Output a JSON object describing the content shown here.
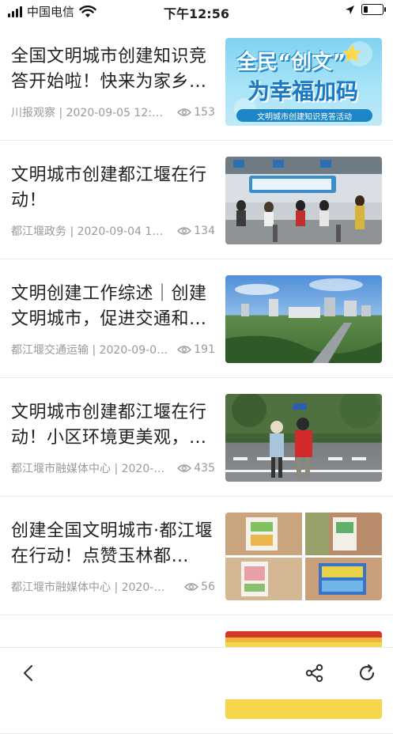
{
  "status_bar": {
    "carrier": "中国电信",
    "time": "下午12:56"
  },
  "articles": [
    {
      "title": "全国文明城市创建知识竞答开始啦！快来为家乡…",
      "source": "川报观察 | 2020-09-05 12:…",
      "views": "153",
      "image": "poster-全民创文为幸福加码",
      "image_text_1": "全民“创文”",
      "image_text_2": "为幸福加码",
      "image_caption": "文明城市创建知识竞答活动"
    },
    {
      "title": "文明城市创建都江堰在行动！",
      "source": "都江堰政务 | 2020-09-04 1…",
      "views": "134",
      "image": "photo-service-hall"
    },
    {
      "title": "文明创建工作综述｜创建文明城市，促进交通和…",
      "source": "都江堰交通运输 | 2020-09-0…",
      "views": "191",
      "image": "photo-city-skyline"
    },
    {
      "title": "文明城市创建都江堰在行动！小区环境更美观，…",
      "source": "都江堰市融媒体中心 | 2020-…",
      "views": "435",
      "image": "photo-volunteer-crosswalk"
    },
    {
      "title": "创建全国文明城市·都江堰在行动！点赞玉林都…",
      "source": "都江堰市融媒体中心 | 2020-0…",
      "views": "56",
      "image": "collage-posters"
    },
    {
      "title": "",
      "source": "",
      "views": "",
      "image": "banner-partial"
    }
  ],
  "icons": {
    "views": "eye-icon",
    "back": "chevron-left-icon",
    "share": "share-icon",
    "refresh": "refresh-icon"
  },
  "colors": {
    "title": "#222222",
    "meta": "#9a9a9a",
    "divider": "#ececec"
  }
}
